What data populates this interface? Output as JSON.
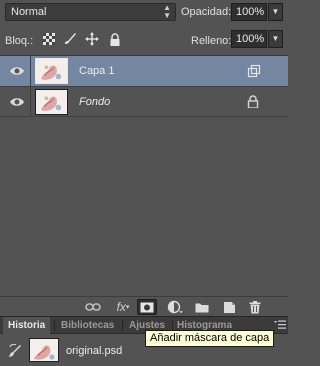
{
  "options": {
    "blend_mode": "Normal",
    "opacity_label": "Opacidad:",
    "opacity_value": "100%",
    "lock_label": "Bloq.:",
    "fill_label": "Relleno:",
    "fill_value": "100%"
  },
  "layers": [
    {
      "name": "Capa 1",
      "visible": true,
      "selected": true,
      "badge": "smart-object-icon"
    },
    {
      "name": "Fondo",
      "visible": true,
      "selected": false,
      "badge": "lock-icon"
    }
  ],
  "toolbar": {
    "fx_label": "fx",
    "icons": [
      "link-layers-icon",
      "fx-icon",
      "add-mask-icon",
      "adjustment-layer-icon",
      "new-group-icon",
      "new-layer-icon",
      "trash-icon"
    ]
  },
  "tabs": [
    {
      "label": "Historia",
      "active": true
    },
    {
      "label": "Bibliotecas",
      "active": false
    },
    {
      "label": "Ajustes",
      "active": false
    },
    {
      "label": "Histograma",
      "active": false
    }
  ],
  "history": {
    "snapshot_name": "original.psd"
  },
  "tooltip": {
    "text": "Añadir máscara de capa"
  },
  "colors": {
    "panel_bg": "#535353",
    "selected_row": "#7387a2",
    "tooltip_bg": "#ffffd8"
  }
}
